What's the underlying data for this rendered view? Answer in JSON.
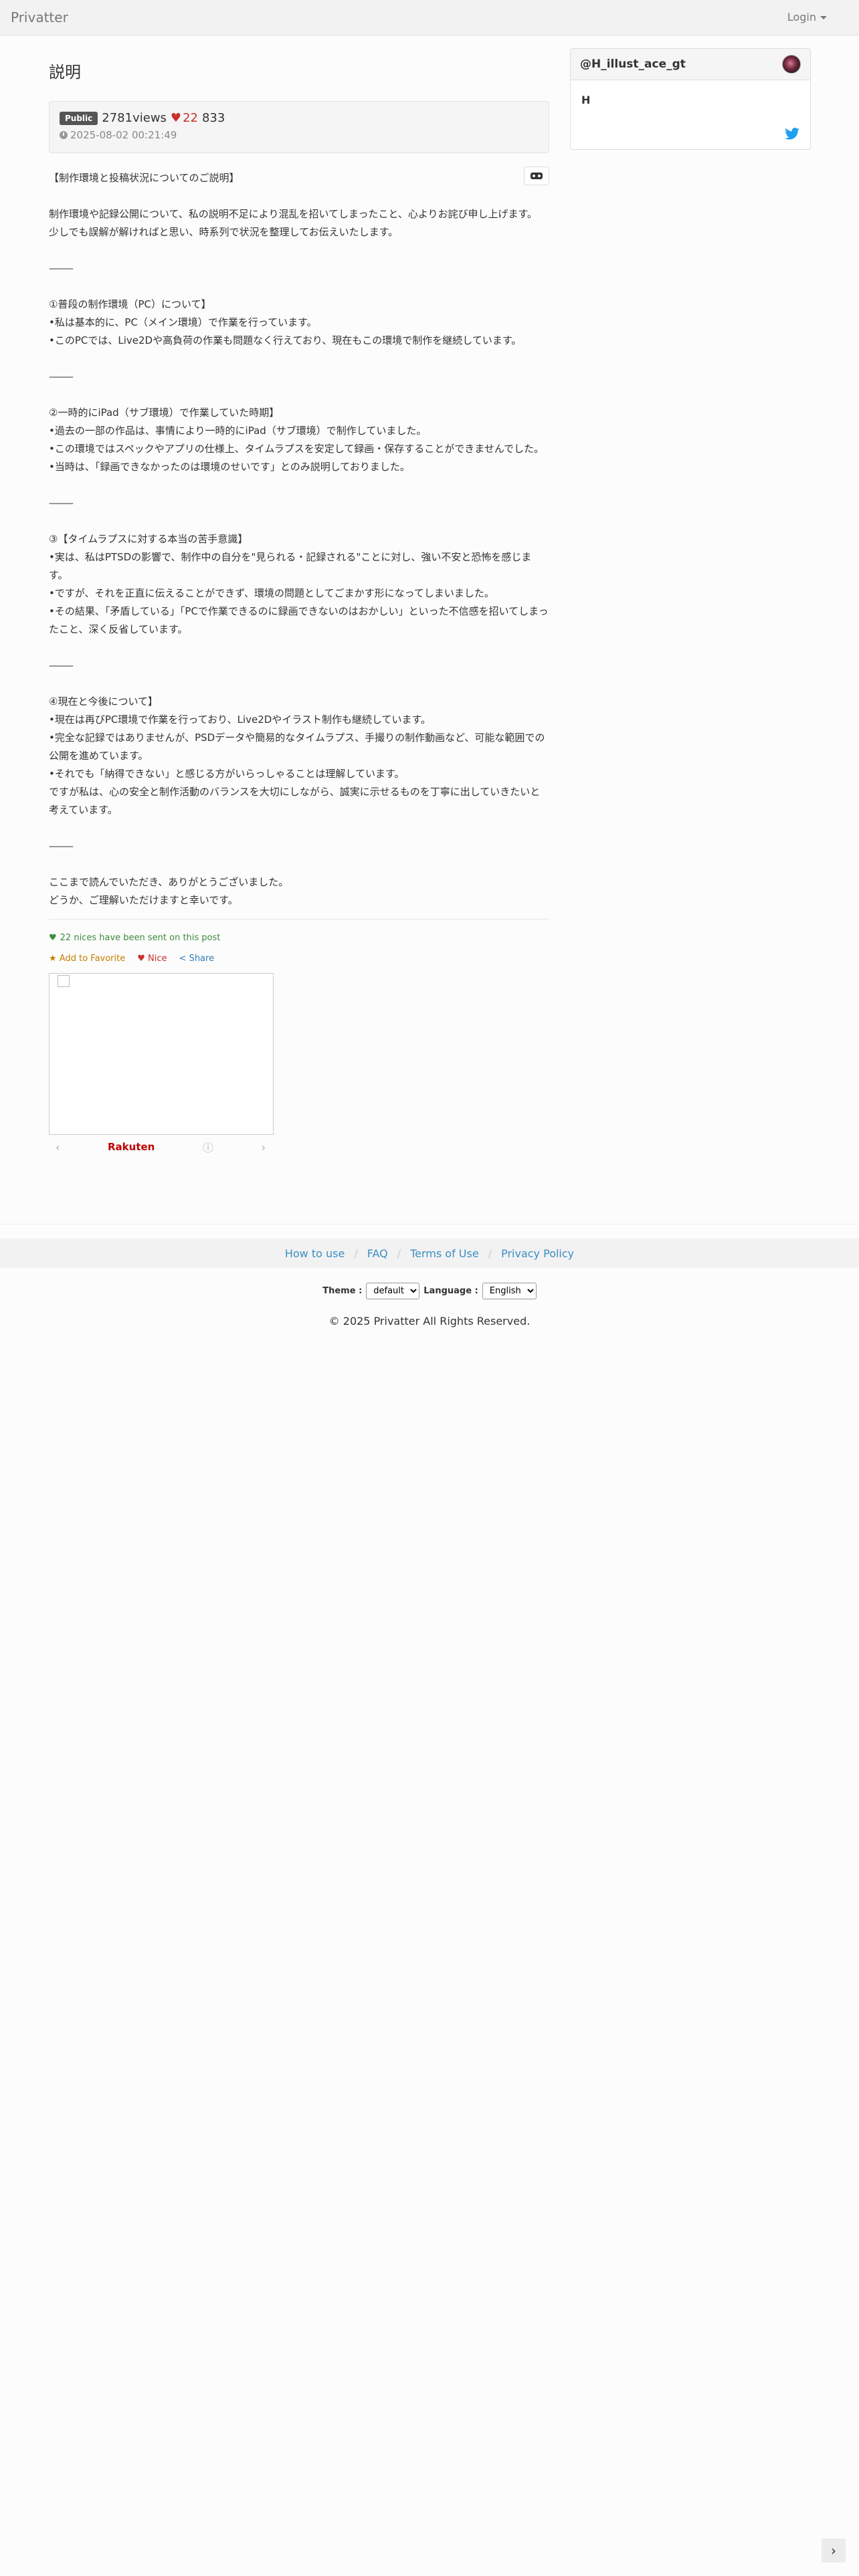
{
  "navbar": {
    "brand": "Privatter",
    "login": "Login"
  },
  "post": {
    "title": "説明",
    "badge": "Public",
    "views": "2781views",
    "nice_count": "22",
    "extra_count": "833",
    "date": "2025-08-02 00:21:49",
    "paragraphs": [
      "【制作環境と投稿状況についてのご説明】",
      "",
      "制作環境や記録公開について、私の説明不足により混乱を招いてしまったこと、心よりお詫び申し上げます。",
      "少しでも誤解が解ければと思い、時系列で状況を整理してお伝えいたします。",
      "",
      "⸻",
      "",
      "①普段の制作環境（PC）について】",
      "•私は基本的に、PC（メイン環境）で作業を行っています。",
      "•このPCでは、Live2Dや高負荷の作業も問題なく行えており、現在もこの環境で制作を継続しています。",
      "",
      "⸻",
      "",
      "②一時的にiPad（サブ環境）で作業していた時期】",
      "•過去の一部の作品は、事情により一時的にiPad（サブ環境）で制作していました。",
      "•この環境ではスペックやアプリの仕様上、タイムラプスを安定して録画・保存することができませんでした。",
      "•当時は、「録画できなかったのは環境のせいです」とのみ説明しておりました。",
      "",
      "⸻",
      "",
      "③【タイムラプスに対する本当の苦手意識】",
      "•実は、私はPTSDの影響で、制作中の自分を\"見られる・記録される\"ことに対し、強い不安と恐怖を感じます。",
      "•ですが、それを正直に伝えることができず、環境の問題としてごまかす形になってしまいました。",
      "•その結果、「矛盾している」「PCで作業できるのに録画できないのはおかしい」といった不信感を招いてしまったこと、深く反省しています。",
      "",
      "⸻",
      "",
      "④現在と今後について】",
      "•現在は再びPC環境で作業を行っており、Live2Dやイラスト制作も継続しています。",
      "•完全な記録ではありませんが、PSDデータや簡易的なタイムラプス、手撮りの制作動画など、可能な範囲での公開を進めています。",
      "•それでも「納得できない」と感じる方がいらっしゃることは理解しています。",
      "ですが私は、心の安全と制作活動のバランスを大切にしながら、誠実に示せるものを丁寧に出していきたいと考えています。",
      "",
      "⸻",
      "",
      "ここまで読んでいただき、ありがとうございました。",
      "どうか、ご理解いただけますと幸いです。"
    ],
    "nices_sent": "22 nices have been sent on this post",
    "actions": {
      "favorite": "Add to Favorite",
      "nice": "Nice",
      "share": "Share"
    },
    "ad": {
      "brand": "Rakuten"
    }
  },
  "sidebar": {
    "username": "@H_illust_ace_gt",
    "bio": "H"
  },
  "footer": {
    "links": [
      "How to use",
      "FAQ",
      "Terms of Use",
      "Privacy Policy"
    ],
    "theme_label": "Theme :",
    "theme_value": "default",
    "language_label": "Language :",
    "language_value": "English",
    "copyright": "© 2025 Privatter All Rights Reserved."
  },
  "colors": {
    "nice_red": "#c9302c",
    "link_blue": "#3a8fc4",
    "twitter_blue": "#1da1f2"
  }
}
